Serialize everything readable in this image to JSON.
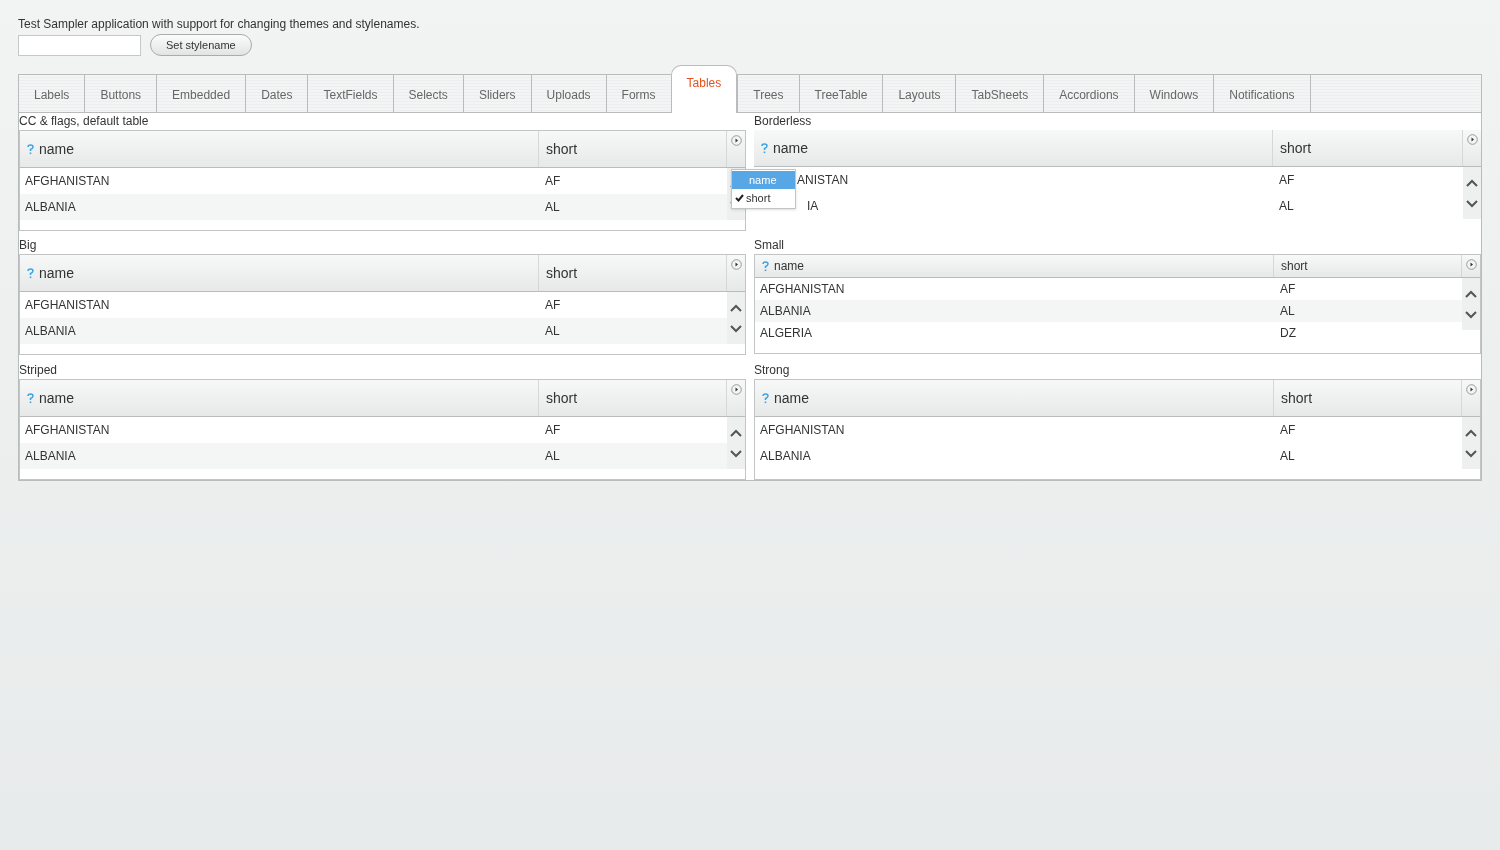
{
  "intro": "Test Sampler application with support for changing themes and stylenames.",
  "set_button": "Set stylename",
  "tabs": [
    {
      "label": "Labels",
      "selected": false
    },
    {
      "label": "Buttons",
      "selected": false
    },
    {
      "label": "Embedded",
      "selected": false
    },
    {
      "label": "Dates",
      "selected": false
    },
    {
      "label": "TextFields",
      "selected": false
    },
    {
      "label": "Selects",
      "selected": false
    },
    {
      "label": "Sliders",
      "selected": false
    },
    {
      "label": "Uploads",
      "selected": false
    },
    {
      "label": "Forms",
      "selected": false
    },
    {
      "label": "Tables",
      "selected": true
    },
    {
      "label": "Trees",
      "selected": false
    },
    {
      "label": "TreeTable",
      "selected": false
    },
    {
      "label": "Layouts",
      "selected": false
    },
    {
      "label": "TabSheets",
      "selected": false
    },
    {
      "label": "Accordions",
      "selected": false
    },
    {
      "label": "Windows",
      "selected": false
    },
    {
      "label": "Notifications",
      "selected": false
    }
  ],
  "tables": [
    {
      "caption": "CC & flags, default table",
      "kind": "default",
      "columns": [
        "name",
        "short"
      ],
      "rows": [
        [
          "AFGHANISTAN",
          "AF"
        ],
        [
          "ALBANIA",
          "AL"
        ]
      ],
      "menu": [
        {
          "label": "name",
          "checked": false,
          "selected": true
        },
        {
          "label": "short",
          "checked": true,
          "selected": false
        }
      ]
    },
    {
      "caption": "Borderless",
      "kind": "borderless",
      "columns": [
        "name",
        "short"
      ],
      "rows": [
        [
          "ANISTAN",
          "AF"
        ],
        [
          "IA",
          "AL"
        ]
      ]
    },
    {
      "caption": "Big",
      "kind": "default",
      "columns": [
        "name",
        "short"
      ],
      "rows": [
        [
          "AFGHANISTAN",
          "AF"
        ],
        [
          "ALBANIA",
          "AL"
        ]
      ]
    },
    {
      "caption": "Small",
      "kind": "small",
      "columns": [
        "name",
        "short"
      ],
      "rows": [
        [
          "AFGHANISTAN",
          "AF"
        ],
        [
          "ALBANIA",
          "AL"
        ],
        [
          "ALGERIA",
          "DZ"
        ]
      ]
    },
    {
      "caption": "Striped",
      "kind": "default",
      "columns": [
        "name",
        "short"
      ],
      "rows": [
        [
          "AFGHANISTAN",
          "AF"
        ],
        [
          "ALBANIA",
          "AL"
        ]
      ]
    },
    {
      "caption": "Strong",
      "kind": "strong",
      "columns": [
        "name",
        "short"
      ],
      "rows": [
        [
          "AFGHANISTAN",
          "AF"
        ],
        [
          "ALBANIA",
          "AL"
        ]
      ]
    }
  ]
}
